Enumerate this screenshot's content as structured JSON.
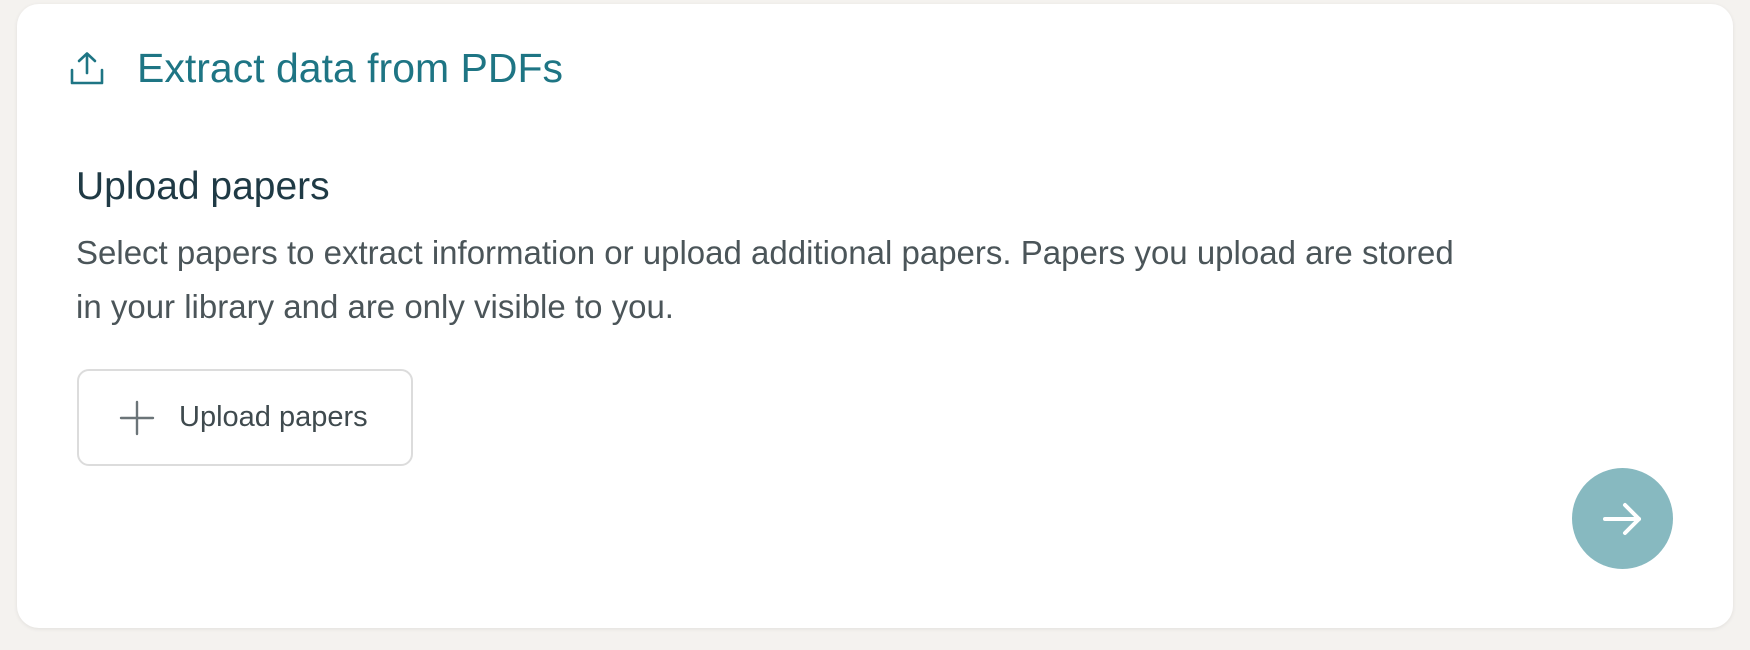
{
  "header": {
    "icon": "upload-icon",
    "title": "Extract data from PDFs"
  },
  "section": {
    "title": "Upload papers",
    "description": "Select papers to extract information or upload additional papers. Papers you upload are stored in your library and are only visible to you."
  },
  "upload_button": {
    "icon": "plus-icon",
    "label": "Upload papers"
  },
  "next_button": {
    "icon": "arrow-right-icon"
  },
  "colors": {
    "accent": "#1e7584",
    "next_button_bg": "#87b9c0",
    "page_bg": "#f4f2ef"
  }
}
